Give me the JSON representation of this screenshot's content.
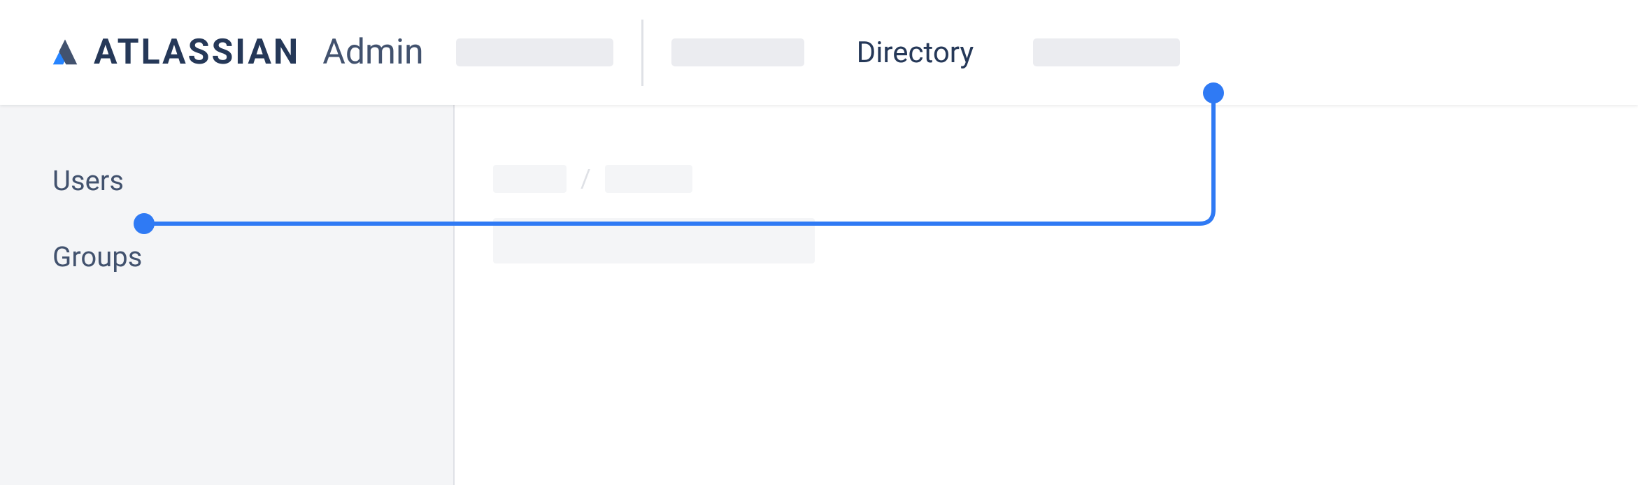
{
  "header": {
    "brand": "ATLASSIAN",
    "product": "Admin",
    "nav_active": "Directory"
  },
  "sidebar": {
    "items": [
      {
        "label": "Users"
      },
      {
        "label": "Groups"
      }
    ]
  },
  "content": {
    "breadcrumb_separator": "/"
  },
  "colors": {
    "accent": "#2F7AF4",
    "text_dark": "#253858",
    "text_muted": "#42526E",
    "placeholder": "#EBECF0",
    "sidebar_bg": "#F4F5F7"
  }
}
